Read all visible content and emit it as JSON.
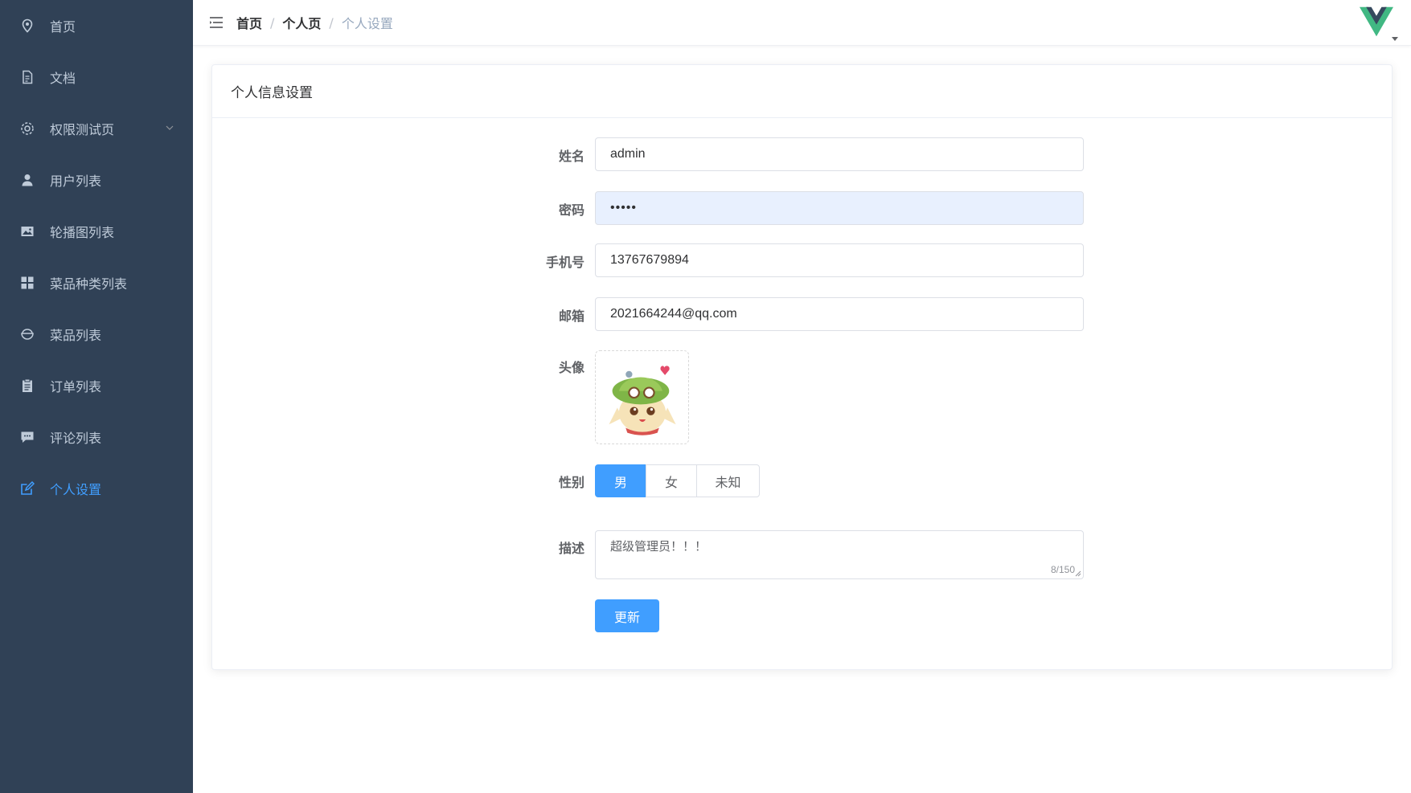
{
  "sidebar": {
    "items": [
      {
        "label": "首页",
        "icon": "location-icon"
      },
      {
        "label": "文档",
        "icon": "document-icon"
      },
      {
        "label": "权限测试页",
        "icon": "gear-icon"
      },
      {
        "label": "用户列表",
        "icon": "user-icon"
      },
      {
        "label": "轮播图列表",
        "icon": "picture-icon"
      },
      {
        "label": "菜品种类列表",
        "icon": "grid-icon"
      },
      {
        "label": "菜品列表",
        "icon": "bowl-icon"
      },
      {
        "label": "订单列表",
        "icon": "clipboard-icon"
      },
      {
        "label": "评论列表",
        "icon": "comment-icon"
      },
      {
        "label": "个人设置",
        "icon": "edit-icon"
      }
    ],
    "active_color": "#409eff",
    "background": "#304156"
  },
  "header": {
    "breadcrumb": [
      "首页",
      "个人页",
      "个人设置"
    ],
    "separator": "/"
  },
  "card": {
    "title": "个人信息设置"
  },
  "form": {
    "name_label": "姓名",
    "name_value": "admin",
    "password_label": "密码",
    "password_value": "•••••",
    "phone_label": "手机号",
    "phone_value": "13767679894",
    "email_label": "邮箱",
    "email_value": "2021664244@qq.com",
    "avatar_label": "头像",
    "gender_label": "性别",
    "gender_options": [
      "男",
      "女",
      "未知"
    ],
    "gender_selected": "男",
    "desc_label": "描述",
    "desc_value": "超级管理员！！！",
    "desc_counter": "8/150",
    "submit_label": "更新"
  }
}
